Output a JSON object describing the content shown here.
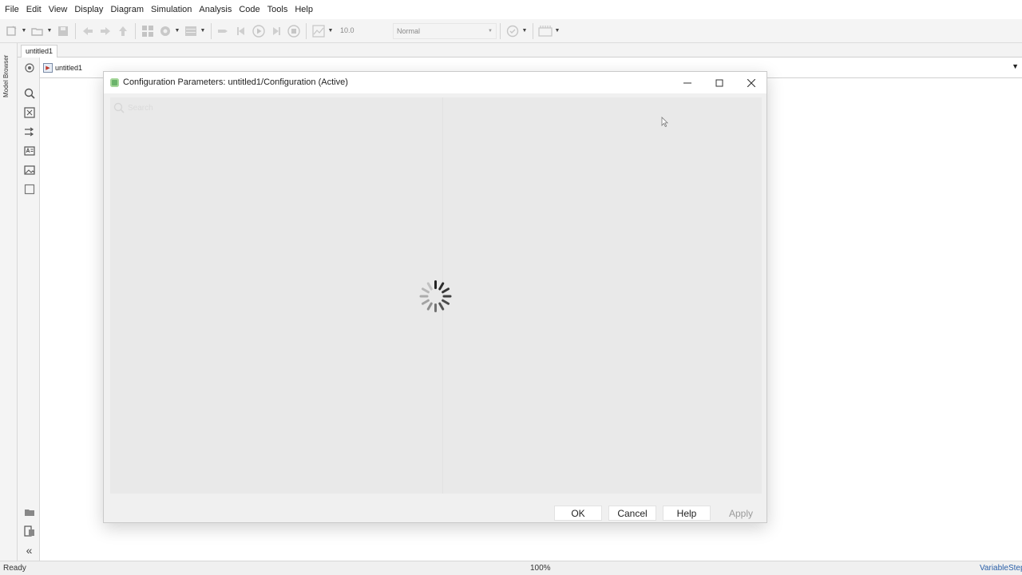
{
  "menubar": {
    "items": [
      "File",
      "Edit",
      "View",
      "Display",
      "Diagram",
      "Simulation",
      "Analysis",
      "Code",
      "Tools",
      "Help"
    ]
  },
  "toolbar": {
    "stop_time": "10.0",
    "sim_mode": "Normal",
    "icons": [
      "new-model-icon",
      "open-icon",
      "save-icon",
      "back-icon",
      "forward-icon",
      "up-icon",
      "library-browser-icon",
      "model-config-icon",
      "model-explorer-icon",
      "build-icon",
      "step-back-icon",
      "run-icon",
      "step-forward-icon",
      "stop-icon",
      "data-inspector-icon",
      "model-advisor-icon",
      "signal-table-icon"
    ]
  },
  "tab": {
    "label": "untitled1"
  },
  "left_strip": {
    "label": "Model Browser"
  },
  "address": {
    "model": "untitled1"
  },
  "dialog": {
    "title": "Configuration Parameters: untitled1/Configuration (Active)",
    "search_placeholder": "Search",
    "loading": true,
    "buttons": {
      "ok": "OK",
      "cancel": "Cancel",
      "help": "Help",
      "apply": "Apply"
    }
  },
  "status": {
    "state": "Ready",
    "zoom": "100%",
    "solver": "VariableStep"
  },
  "colors": {
    "accent": "#2a5fa8",
    "dialog_bg": "#f0f0f0",
    "body_bg": "#e9e9e9"
  }
}
